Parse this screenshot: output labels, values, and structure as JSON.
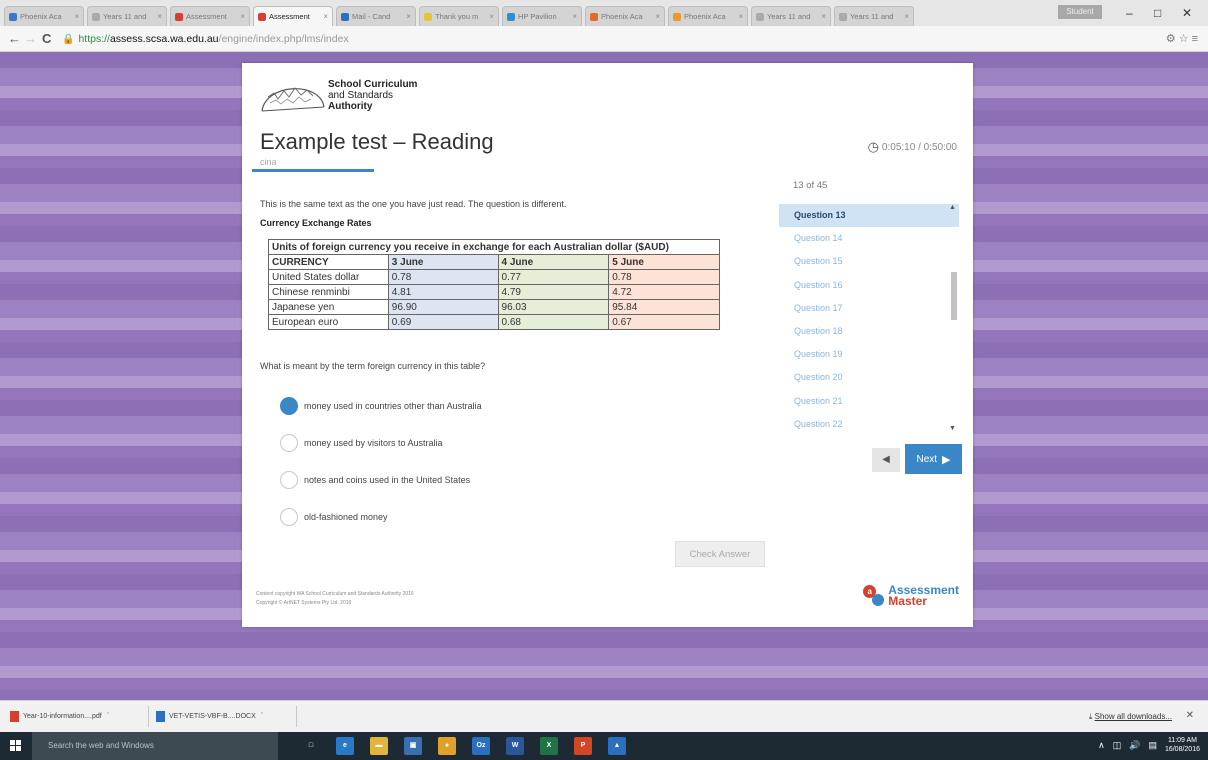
{
  "browser": {
    "tabs": [
      {
        "title": "Phoenix Aca",
        "color": "#3b78c9",
        "active": false
      },
      {
        "title": "Years 11 and",
        "color": "#aaaaaa",
        "active": false
      },
      {
        "title": "Assessment",
        "color": "#d6402e",
        "active": false
      },
      {
        "title": "Assessment",
        "color": "#d6402e",
        "active": true
      },
      {
        "title": "Mail - Cand",
        "color": "#2a6fc0",
        "active": false
      },
      {
        "title": "Thank you m",
        "color": "#e8c33a",
        "active": false
      },
      {
        "title": "HP Pavilion",
        "color": "#2d8fd1",
        "active": false
      },
      {
        "title": "Phoenix Aca",
        "color": "#e36a2a",
        "active": false
      },
      {
        "title": "Phoenix Aca",
        "color": "#e89a2a",
        "active": false
      },
      {
        "title": "Years 11 and",
        "color": "#aaaaaa",
        "active": false
      },
      {
        "title": "Years 11 and",
        "color": "#aaaaaa",
        "active": false
      }
    ],
    "profile": "Student",
    "url_protocol": "https://",
    "url_domain": "assess.scsa.wa.edu.au",
    "url_path": "/engine/index.php/lms/index"
  },
  "header": {
    "org_line1": "School Curriculum",
    "org_line2": "and Standards",
    "org_line3": "Authority",
    "test_title": "Example test – Reading",
    "subtitle": "cina",
    "timer": "0:05:10 / 0:50:00"
  },
  "question": {
    "intro": "This is the same text as the one you have just read. The question is different.",
    "table_heading": "Currency Exchange Rates",
    "table_caption": "Units of foreign currency you receive in exchange for each Australian dollar ($AUD)",
    "columns": [
      "CURRENCY",
      "3 June",
      "4 June",
      "5 June"
    ],
    "rows": [
      [
        "United States dollar",
        "0.78",
        "0.77",
        "0.78"
      ],
      [
        "Chinese renminbi",
        "4.81",
        "4.79",
        "4.72"
      ],
      [
        "Japanese yen",
        "96.90",
        "96.03",
        "95.84"
      ],
      [
        "European euro",
        "0.69",
        "0.68",
        "0.67"
      ]
    ],
    "prompt": "What is meant by the term foreign currency in this table?",
    "options": [
      {
        "label": "money used in countries other than Australia",
        "selected": true
      },
      {
        "label": "money used by visitors to Australia",
        "selected": false
      },
      {
        "label": "notes and coins used in the United States",
        "selected": false
      },
      {
        "label": "old-fashioned money",
        "selected": false
      }
    ],
    "check_answer_label": "Check Answer"
  },
  "navigator": {
    "counter": "13 of 45",
    "items": [
      "Question 13",
      "Question 14",
      "Question 15",
      "Question 16",
      "Question 17",
      "Question 18",
      "Question 19",
      "Question 20",
      "Question 21",
      "Question 22"
    ],
    "current_index": 0,
    "next_label": "Next"
  },
  "footer": {
    "copyright1": "Content copyright WA School Curriculum and Standards Authority 2016",
    "copyright2": "Copyright © ArtNET Systems Pty Ltd. 2016",
    "brand_line1": "Assessment",
    "brand_line2": "Master"
  },
  "downloads": [
    {
      "name": "Year-10-information....pdf",
      "icon_color": "#d6402e"
    },
    {
      "name": "VET-VETIS-VBF-B....DOCX",
      "icon_color": "#2a6fc0"
    }
  ],
  "downloads_show_all": "Show all downloads...",
  "taskbar": {
    "search_placeholder": "Search the web and Windows",
    "apps": [
      {
        "name": "task-view-icon",
        "glyph": "□",
        "color": "#1e2a33"
      },
      {
        "name": "edge-icon",
        "glyph": "e",
        "color": "#2a78c8"
      },
      {
        "name": "file-explorer-icon",
        "glyph": "▬",
        "color": "#e2b53a"
      },
      {
        "name": "store-icon",
        "glyph": "▣",
        "color": "#3b6fb3"
      },
      {
        "name": "chrome-icon",
        "glyph": "●",
        "color": "#e0a02a"
      },
      {
        "name": "outlook-icon",
        "glyph": "Oz",
        "color": "#2a6fc0"
      },
      {
        "name": "word-icon",
        "glyph": "W",
        "color": "#2b579a"
      },
      {
        "name": "excel-icon",
        "glyph": "X",
        "color": "#217346"
      },
      {
        "name": "powerpoint-icon",
        "glyph": "P",
        "color": "#d24726"
      },
      {
        "name": "photos-icon",
        "glyph": "▲",
        "color": "#2a6fc0"
      }
    ],
    "time": "11:09 AM",
    "date": "16/08/2016"
  }
}
